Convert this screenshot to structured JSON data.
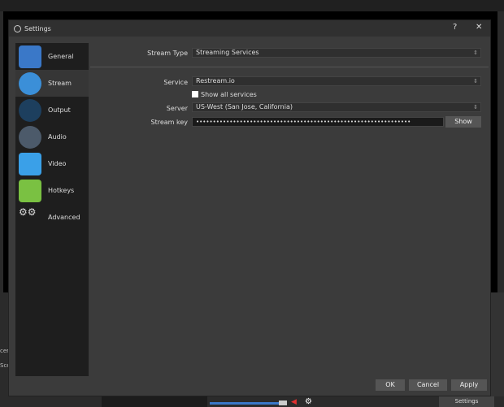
{
  "window": {
    "title": "Settings",
    "help": "?",
    "close": "✕"
  },
  "sidebar": {
    "items": [
      {
        "label": "General",
        "icon": "general-icon",
        "color": "#3a78c8"
      },
      {
        "label": "Stream",
        "icon": "stream-globe-icon",
        "color": "#3b8fd8"
      },
      {
        "label": "Output",
        "icon": "output-broadcast-icon",
        "color": "#1d3f5e"
      },
      {
        "label": "Audio",
        "icon": "audio-speaker-icon",
        "color": "#4c5a6a"
      },
      {
        "label": "Video",
        "icon": "video-monitor-icon",
        "color": "#3aa0e8"
      },
      {
        "label": "Hotkeys",
        "icon": "hotkeys-keyboard-icon",
        "color": "#7ac142"
      },
      {
        "label": "Advanced",
        "icon": "advanced-gears-icon",
        "color": "#1e1e1e"
      }
    ],
    "selected": "Stream"
  },
  "stream": {
    "stream_type_label": "Stream Type",
    "stream_type": "Streaming Services",
    "service_label": "Service",
    "service": "Restream.io",
    "show_all_label": "Show all services",
    "show_all_checked": false,
    "server_label": "Server",
    "server": "US-West (San Jose, California)",
    "key_label": "Stream key",
    "key": "••••••••••••••••••••••••••••••••••••••••••••••••••••••••••••••••",
    "show_label": "Show"
  },
  "footer": {
    "ok": "OK",
    "cancel": "Cancel",
    "apply": "Apply"
  },
  "background": {
    "left_text_1": "cer",
    "left_text_2": "Sce",
    "settings_button": "Settings"
  }
}
